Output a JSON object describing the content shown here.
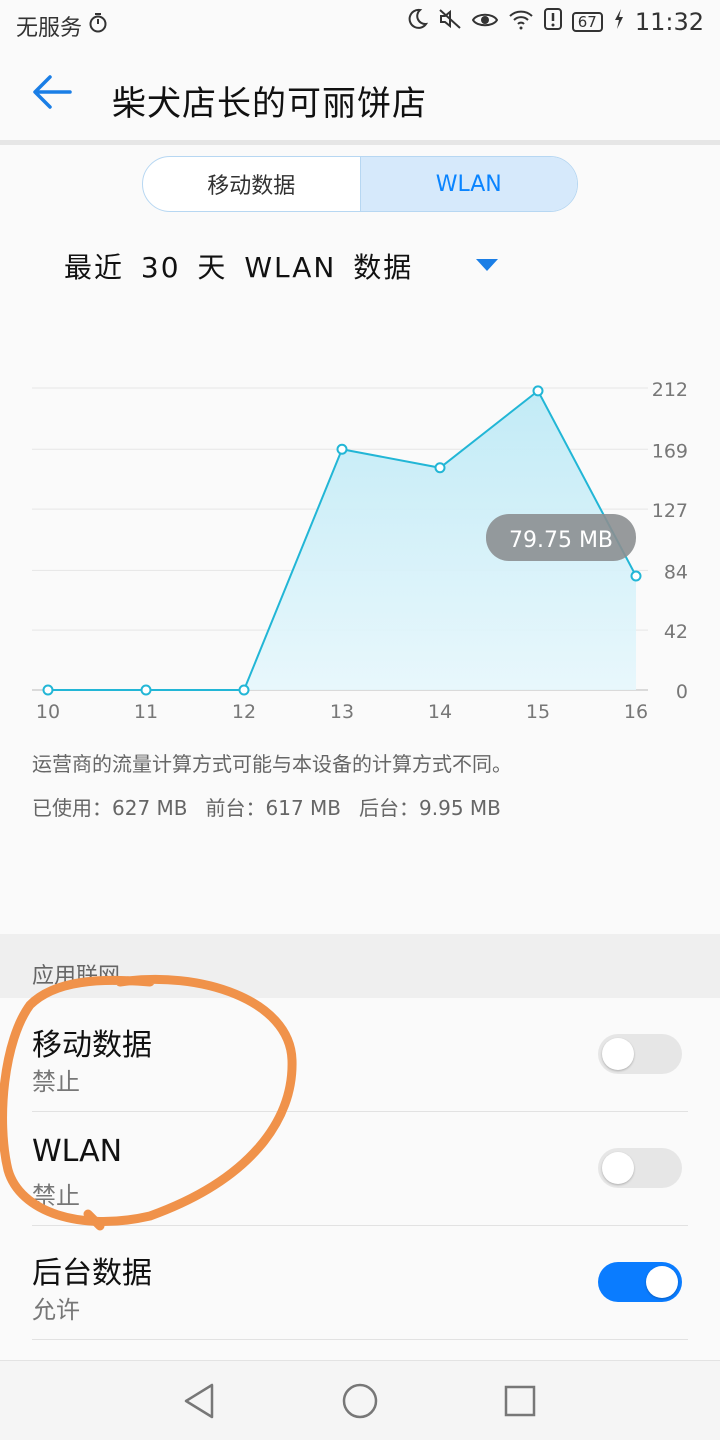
{
  "status_bar": {
    "left_text": "无服务",
    "left_icon": "stopwatch-icon",
    "right_icons": [
      "moon-icon",
      "mute-icon",
      "eye-icon",
      "wifi-icon",
      "alert-icon"
    ],
    "battery": "67",
    "charging_icon": "bolt-icon",
    "time": "11:32"
  },
  "header": {
    "back_icon": "arrow-left-icon",
    "title": "柴犬店长的可丽饼店"
  },
  "segment": {
    "tabs": [
      {
        "label": "移动数据",
        "active": false
      },
      {
        "label": "WLAN",
        "active": true
      }
    ]
  },
  "range_selector": {
    "label": "最近 30 天 WLAN 数据",
    "icon": "dropdown-triangle-icon"
  },
  "chart_data": {
    "type": "area",
    "x": [
      "10",
      "11",
      "12",
      "13",
      "14",
      "15",
      "16"
    ],
    "values": [
      0,
      0,
      0,
      169,
      156,
      210,
      80
    ],
    "y_ticks": [
      "212",
      "169",
      "127",
      "84",
      "42",
      "0"
    ],
    "ylim": [
      0,
      212
    ],
    "tooltip": "79.75 MB",
    "line_color": "#22b6d6",
    "fill_color": "#bfeaf6"
  },
  "note": "运营商的流量计算方式可能与本设备的计算方式不同。",
  "usage": {
    "used": "已使用：627 MB",
    "foreground": "前台：617 MB",
    "background": "后台：9.95 MB"
  },
  "section": {
    "title": "应用联网"
  },
  "rows": [
    {
      "title": "移动数据",
      "subtitle": "禁止",
      "enabled": false
    },
    {
      "title": "WLAN",
      "subtitle": "禁止",
      "enabled": false
    },
    {
      "title": "后台数据",
      "subtitle": "允许",
      "enabled": true
    }
  ],
  "annotation_color": "#f0924a",
  "nav": {
    "back": "triangle-back-icon",
    "home": "circle-home-icon",
    "recents": "square-recents-icon"
  }
}
